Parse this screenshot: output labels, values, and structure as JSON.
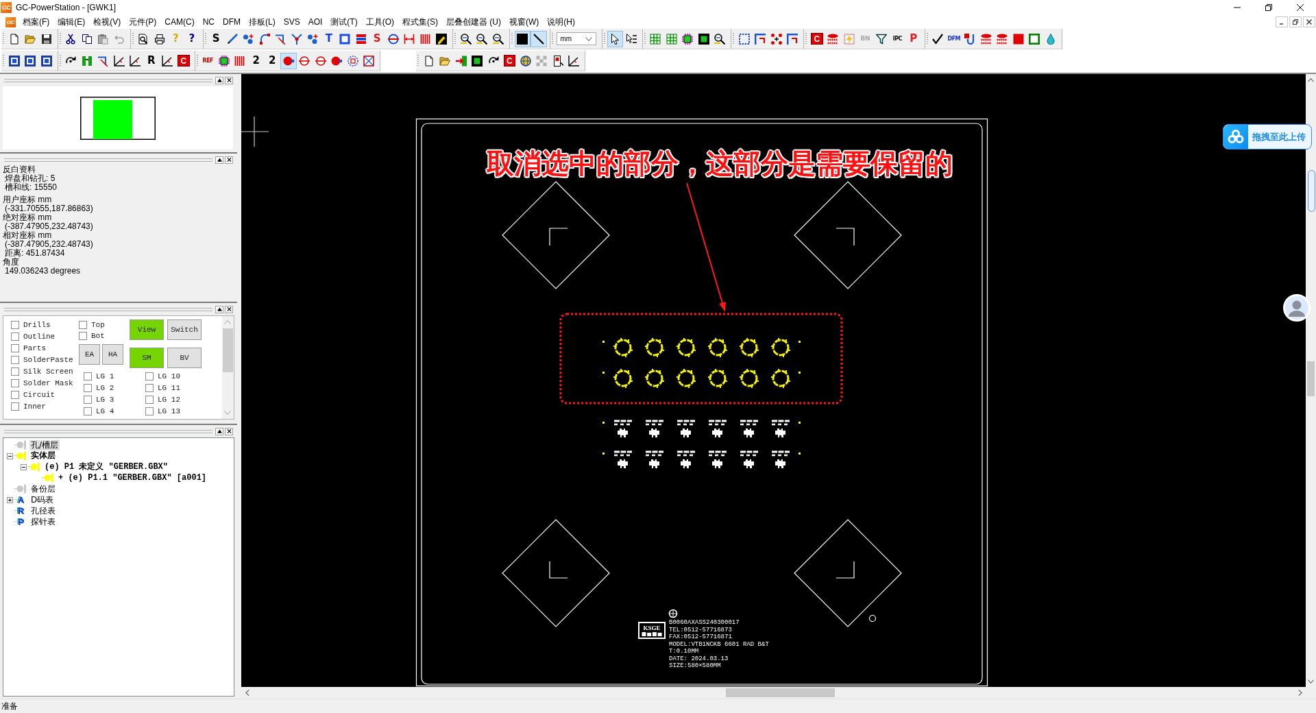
{
  "window": {
    "app_badge": "GC",
    "title": "GC-PowerStation - [GWK1]"
  },
  "menu_bar": {
    "document_badge": "GC",
    "items": [
      "档案(F)",
      "编辑(E)",
      "检视(V)",
      "元件(P)",
      "CAM(C)",
      "NC",
      "DFM",
      "排板(L)",
      "SVS",
      "AOI",
      "测试(T)",
      "工具(O)",
      "程式集(S)",
      "层叠创建器 (U)",
      "视窗(W)",
      "说明(H)"
    ]
  },
  "toolbar_rows": [
    {
      "toolbars": [
        {
          "buttons": [
            {
              "kind": "page",
              "pressed": false
            },
            {
              "kind": "folder",
              "pressed": false
            },
            {
              "kind": "disk",
              "pressed": false
            }
          ]
        },
        {
          "buttons": [
            {
              "kind": "scissors",
              "pressed": false
            },
            {
              "kind": "copy",
              "pressed": false
            },
            {
              "kind": "clipboard",
              "pressed": false
            },
            {
              "kind": "undo",
              "pressed": false
            }
          ]
        },
        {
          "buttons": [
            {
              "kind": "preview",
              "pressed": false
            },
            {
              "kind": "printer",
              "pressed": false
            },
            {
              "kind": "glyph",
              "label": "?",
              "color": "#d8a800",
              "pressed": false
            },
            {
              "kind": "glyph",
              "label": "?",
              "color": "#000080",
              "pressed": false
            }
          ]
        },
        {
          "buttons": [
            {
              "kind": "glyph",
              "label": "S",
              "color": "#000000",
              "pressed": false
            },
            {
              "kind": "pen",
              "pressed": false
            },
            {
              "kind": "nodes",
              "pressed": false
            },
            {
              "kind": "arc",
              "pressed": false
            },
            {
              "kind": "bracket",
              "pressed": false
            },
            {
              "kind": "fork",
              "pressed": false
            },
            {
              "kind": "nodes",
              "pressed": false
            },
            {
              "kind": "glyph",
              "label": "T",
              "color": "#1040e0",
              "pressed": false
            },
            {
              "kind": "square",
              "pressed": false
            },
            {
              "kind": "bars",
              "pressed": false
            },
            {
              "kind": "glyph",
              "label": "S",
              "color": "#d02020",
              "pressed": false
            },
            {
              "kind": "target",
              "pressed": false
            },
            {
              "kind": "dimension",
              "pressed": false
            },
            {
              "kind": "stripes",
              "pressed": false
            },
            {
              "kind": "pencil",
              "pressed": false
            }
          ]
        },
        {
          "buttons": [
            {
              "kind": "zoom",
              "pressed": false
            },
            {
              "kind": "zoom",
              "pressed": false
            },
            {
              "kind": "zoom",
              "pressed": false
            }
          ]
        },
        {
          "buttons": [
            {
              "kind": "pad",
              "pressed": true
            },
            {
              "kind": "line",
              "pressed": true
            }
          ]
        },
        {
          "buttons": [
            {
              "kind": "dropdown",
              "value": "mm"
            }
          ]
        },
        {
          "buttons": [
            {
              "kind": "cursor",
              "pressed": true
            },
            {
              "kind": "select",
              "pressed": false
            }
          ]
        },
        {
          "buttons": [
            {
              "kind": "grid",
              "pressed": false
            },
            {
              "kind": "grid",
              "pressed": false
            },
            {
              "kind": "chip",
              "pressed": false
            },
            {
              "kind": "inset",
              "pressed": false
            },
            {
              "kind": "zoom",
              "pressed": false
            }
          ]
        },
        {
          "buttons": [
            {
              "kind": "dashed",
              "pressed": false
            },
            {
              "kind": "corner",
              "pressed": false
            },
            {
              "kind": "dots",
              "pressed": false
            },
            {
              "kind": "corner",
              "pressed": false
            }
          ]
        },
        {
          "buttons": [
            {
              "kind": "tile",
              "label": "C",
              "color": "#e00000",
              "pressed": false
            },
            {
              "kind": "layers",
              "pressed": false
            },
            {
              "kind": "spark",
              "pressed": false
            },
            {
              "kind": "glyph",
              "label": "BN",
              "color": "#a8a8a8",
              "pressed": false
            },
            {
              "kind": "funnel",
              "pressed": false
            },
            {
              "kind": "glyph",
              "label": "IPC",
              "color": "#000000",
              "pressed": false
            },
            {
              "kind": "glyph",
              "label": "P",
              "color": "#e02020",
              "pressed": false
            }
          ]
        },
        {
          "buttons": [
            {
              "kind": "check",
              "pressed": false
            },
            {
              "kind": "glyph",
              "label": "DFM",
              "color": "#1030d0",
              "pressed": false
            },
            {
              "kind": "ushape",
              "pressed": false
            },
            {
              "kind": "layers",
              "pressed": false
            },
            {
              "kind": "layers",
              "pressed": false
            },
            {
              "kind": "fillsq",
              "pressed": false
            },
            {
              "kind": "outsq",
              "pressed": false
            },
            {
              "kind": "drop",
              "pressed": false
            }
          ]
        }
      ]
    },
    {
      "toolbars": [
        {
          "buttons": [
            {
              "kind": "framed",
              "pressed": false
            },
            {
              "kind": "framed",
              "pressed": false
            },
            {
              "kind": "framed",
              "pressed": false
            }
          ]
        },
        {
          "buttons": [
            {
              "kind": "refresh",
              "pressed": false
            },
            {
              "kind": "pillars",
              "pressed": false
            },
            {
              "kind": "bracket",
              "pressed": false
            },
            {
              "kind": "angle",
              "pressed": false
            },
            {
              "kind": "angle",
              "pressed": false
            },
            {
              "kind": "glyph",
              "label": "R",
              "color": "#000000",
              "pressed": false
            },
            {
              "kind": "angle",
              "pressed": false
            },
            {
              "kind": "tile",
              "label": "C",
              "color": "#e00000",
              "pressed": false
            }
          ]
        },
        {
          "buttons": [
            {
              "kind": "glyph",
              "label": "REF",
              "color": "#c00000",
              "pressed": false
            },
            {
              "kind": "chip",
              "pressed": false
            },
            {
              "kind": "stripes",
              "pressed": false
            },
            {
              "kind": "glyph",
              "label": "2",
              "color": "#000000",
              "pressed": false
            },
            {
              "kind": "glyph",
              "label": "2",
              "color": "#000000",
              "pressed": false
            },
            {
              "kind": "circdot",
              "pressed": true
            },
            {
              "kind": "circline",
              "pressed": false
            },
            {
              "kind": "circline",
              "pressed": false
            },
            {
              "kind": "circdot",
              "pressed": false
            },
            {
              "kind": "dashcirc",
              "pressed": false
            },
            {
              "kind": "squarex",
              "pressed": false
            }
          ]
        },
        {
          "buttons": [
            {
              "kind": "page",
              "pressed": false
            },
            {
              "kind": "folder",
              "pressed": false
            },
            {
              "kind": "arrowin",
              "pressed": false
            },
            {
              "kind": "inset",
              "pressed": false
            },
            {
              "kind": "refresh",
              "pressed": false
            },
            {
              "kind": "tile",
              "label": "C",
              "color": "#e00000",
              "pressed": false
            },
            {
              "kind": "globe",
              "pressed": false
            },
            {
              "kind": "greydots",
              "pressed": false
            },
            {
              "kind": "device",
              "pressed": false
            },
            {
              "kind": "angle",
              "pressed": false
            }
          ]
        }
      ]
    }
  ],
  "info_panel": {
    "sections": [
      {
        "heading": "反白资料",
        "lines": [
          "焊盘和钻孔: 5",
          "槽和线: 15550"
        ]
      },
      {
        "heading": "用户座标 mm",
        "lines": [
          "(-331.70555,187.86863)"
        ]
      },
      {
        "heading": "绝对座标 mm",
        "lines": [
          "(-387.47905,232.48743)"
        ]
      },
      {
        "heading": "相对座标 mm",
        "lines": [
          "(-387.47905,232.48743)",
          "距离: 451.87434"
        ]
      },
      {
        "heading": "角度",
        "lines": [
          "149.036243 degrees"
        ]
      }
    ]
  },
  "layers_panel": {
    "layer_checks": [
      {
        "label": "Drills",
        "checked": false
      },
      {
        "label": "Outline",
        "checked": false
      },
      {
        "label": "Parts",
        "checked": false
      },
      {
        "label": "SolderPaste",
        "checked": false
      },
      {
        "label": "Silk Screen",
        "checked": false
      },
      {
        "label": "Solder Mask",
        "checked": false
      },
      {
        "label": "Circuit",
        "checked": false
      },
      {
        "label": "Inner",
        "checked": false
      }
    ],
    "side_checks": [
      {
        "label": "Top",
        "checked": false
      },
      {
        "label": "Bot",
        "checked": false
      }
    ],
    "mode_buttons": [
      {
        "label": "EA",
        "on": false
      },
      {
        "label": "HA",
        "on": false
      }
    ],
    "view_buttons": [
      {
        "label": "View",
        "on": true
      },
      {
        "label": "Switch",
        "on": false
      },
      {
        "label": "SM",
        "on": true
      },
      {
        "label": "BV",
        "on": false
      }
    ],
    "lg_left": [
      {
        "label": "LG 1",
        "checked": false
      },
      {
        "label": "LG 2",
        "checked": false
      },
      {
        "label": "LG 3",
        "checked": false
      },
      {
        "label": "LG 4",
        "checked": false
      }
    ],
    "lg_right": [
      {
        "label": "LG 10",
        "checked": false
      },
      {
        "label": "LG 11",
        "checked": false
      },
      {
        "label": "LG 12",
        "checked": false
      },
      {
        "label": "LG 13",
        "checked": false
      }
    ]
  },
  "tree": {
    "nodes": [
      {
        "label": "孔/槽层",
        "kind": "layer",
        "active": false,
        "selected": true
      },
      {
        "label": "实体层",
        "kind": "layer",
        "active": true,
        "selected": false,
        "expanded": true,
        "children": [
          {
            "label": "(e) P1 未定义 \"GERBER.GBX\"",
            "kind": "layer",
            "active": true,
            "selected": false,
            "expanded": true,
            "children": [
              {
                "label": "+ (e) P1.1 \"GERBER.GBX\" [a001]",
                "kind": "layer",
                "active": true,
                "selected": false
              }
            ]
          }
        ]
      },
      {
        "label": "备份层",
        "kind": "layer",
        "active": false,
        "selected": false
      },
      {
        "label": "D码表",
        "kind": "table",
        "badge": "A",
        "active": false,
        "selected": false,
        "expanded": false
      },
      {
        "label": "孔径表",
        "kind": "table",
        "badge": "R",
        "active": false,
        "selected": false
      },
      {
        "label": "探针表",
        "kind": "table",
        "badge": "P",
        "active": false,
        "selected": false
      }
    ]
  },
  "canvas": {
    "annotation_text": "取消选中的部分，这部分是需要保留的",
    "pad_rows": [
      {
        "pads": [
          {
            "selected": true
          },
          {
            "selected": true
          },
          {
            "selected": true
          },
          {
            "selected": true
          },
          {
            "selected": true
          },
          {
            "selected": true
          }
        ]
      },
      {
        "pads": [
          {
            "selected": true
          },
          {
            "selected": true
          },
          {
            "selected": true
          },
          {
            "selected": true
          },
          {
            "selected": true
          },
          {
            "selected": true
          }
        ]
      },
      {
        "pads": [
          {
            "selected": false
          },
          {
            "selected": false
          },
          {
            "selected": false
          },
          {
            "selected": false
          },
          {
            "selected": false
          },
          {
            "selected": false
          }
        ]
      },
      {
        "pads": [
          {
            "selected": false
          },
          {
            "selected": false
          },
          {
            "selected": false
          },
          {
            "selected": false
          },
          {
            "selected": false
          },
          {
            "selected": false
          }
        ]
      }
    ],
    "silkscreen": {
      "logo": "KSGE",
      "lines": [
        "B0060AXASS240300017",
        "TEL:0512-57716873",
        "FAX:0512-57716871",
        "MODEL:VTB1NCKB 6601 RAD B&T",
        "T:0.10MM",
        "DATE: 2024.03.13",
        "SIZE:580×580MM"
      ]
    }
  },
  "upload_widget": {
    "label": "拖拽至此上传"
  },
  "status_bar": {
    "text": "准备"
  }
}
